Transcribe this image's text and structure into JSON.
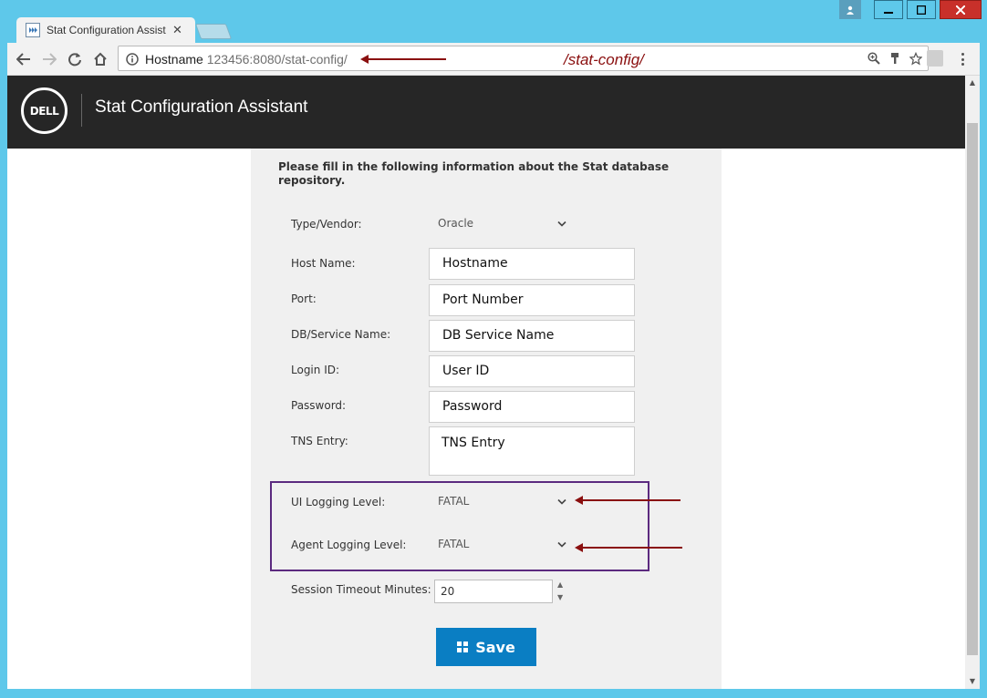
{
  "browser": {
    "tab_title": "Stat Configuration Assist",
    "url_host": "Hostname",
    "url_port_path": " 123456:8080/stat-config/",
    "annotation_url": "/stat-config/"
  },
  "app": {
    "logo_text": "DELL",
    "title": "Stat Configuration Assistant"
  },
  "form": {
    "intro": "Please fill in the following information about the Stat database repository.",
    "type_label": "Type/Vendor:",
    "type_value": "Oracle",
    "host_label": "Host Name:",
    "host_value": "Hostname",
    "port_label": "Port:",
    "port_value": "Port Number",
    "db_label": "DB/Service Name:",
    "db_value": "DB Service Name",
    "login_label": "Login ID:",
    "login_value": "User ID",
    "password_label": "Password:",
    "password_value": "Password",
    "tns_label": "TNS Entry:",
    "tns_value": "TNS Entry",
    "ui_log_label": "UI Logging Level:",
    "ui_log_value": "FATAL",
    "agent_log_label": "Agent Logging Level:",
    "agent_log_value": "FATAL",
    "timeout_label": "Session Timeout Minutes:",
    "timeout_value": "20",
    "save_label": "Save"
  },
  "colors": {
    "header_bg": "#262626",
    "save_button": "#0a7ec3",
    "annotation": "#8a0f0f",
    "highlight_box": "#5b2a7f"
  }
}
